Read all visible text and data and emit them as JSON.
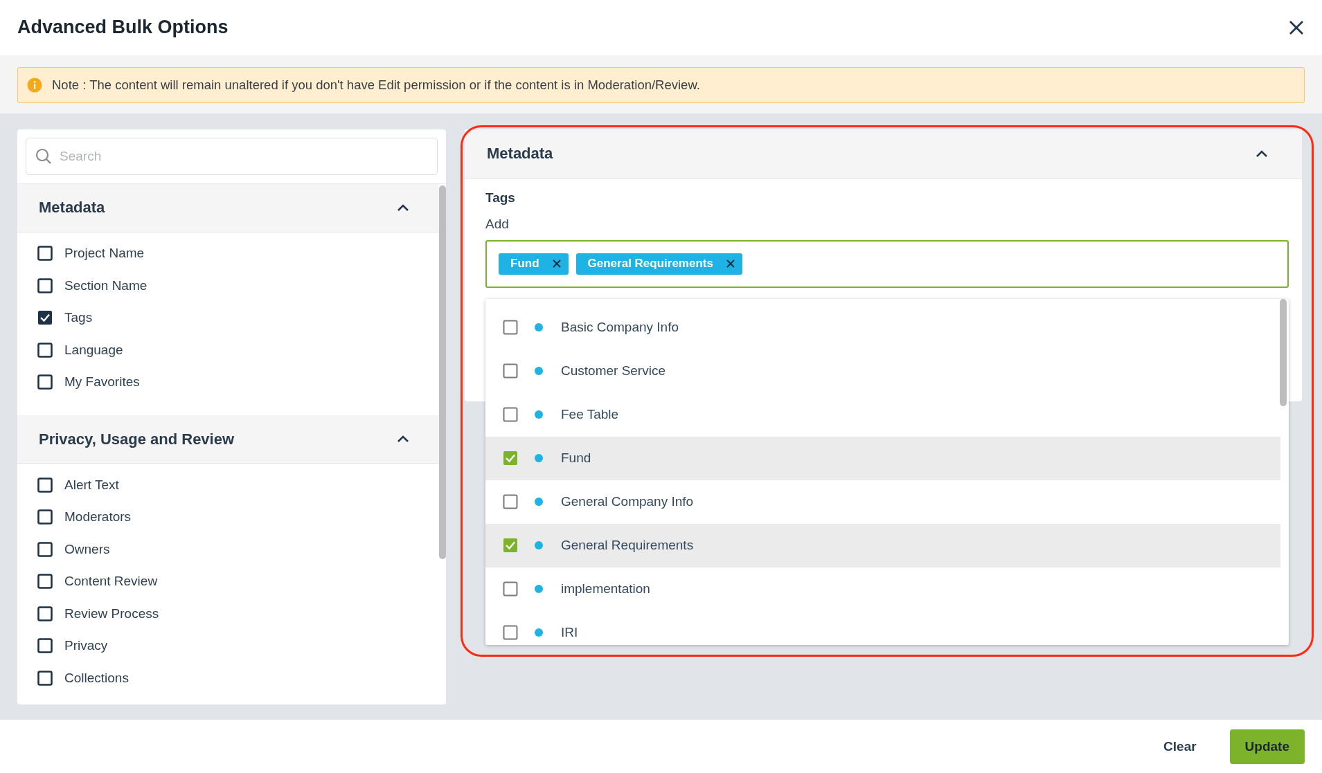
{
  "dialog": {
    "title": "Advanced Bulk Options"
  },
  "notice": {
    "text": "Note : The content will remain unaltered if you don't have Edit permission or if the content is in Moderation/Review."
  },
  "sidebar": {
    "search": {
      "placeholder": "Search"
    },
    "sections": [
      {
        "title": "Metadata",
        "expanded": true,
        "items": [
          {
            "label": "Project Name",
            "checked": false
          },
          {
            "label": "Section Name",
            "checked": false
          },
          {
            "label": "Tags",
            "checked": true
          },
          {
            "label": "Language",
            "checked": false
          },
          {
            "label": "My Favorites",
            "checked": false
          }
        ]
      },
      {
        "title": "Privacy, Usage and Review",
        "expanded": true,
        "items": [
          {
            "label": "Alert Text",
            "checked": false
          },
          {
            "label": "Moderators",
            "checked": false
          },
          {
            "label": "Owners",
            "checked": false
          },
          {
            "label": "Content Review",
            "checked": false
          },
          {
            "label": "Review Process",
            "checked": false
          },
          {
            "label": "Privacy",
            "checked": false
          },
          {
            "label": "Collections",
            "checked": false
          }
        ]
      }
    ]
  },
  "editor": {
    "highlighted": true,
    "section": {
      "title": "Metadata",
      "expanded": true
    },
    "field_label": "Tags",
    "add_label": "Add",
    "tags": [
      {
        "label": "Fund"
      },
      {
        "label": "General Requirements"
      }
    ],
    "options": [
      {
        "label": "Basic Company Info",
        "checked": false
      },
      {
        "label": "Customer Service",
        "checked": false
      },
      {
        "label": "Fee Table",
        "checked": false
      },
      {
        "label": "Fund",
        "checked": true
      },
      {
        "label": "General Company Info",
        "checked": false
      },
      {
        "label": "General Requirements",
        "checked": true
      },
      {
        "label": "implementation",
        "checked": false
      },
      {
        "label": "IRI",
        "checked": false
      }
    ]
  },
  "footer": {
    "buttons": [
      {
        "label": "Clear",
        "kind": "text"
      },
      {
        "label": "Update",
        "kind": "primary"
      }
    ]
  }
}
